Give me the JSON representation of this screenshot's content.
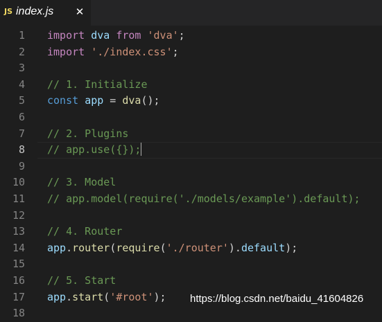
{
  "tab": {
    "icon_text": "JS",
    "filename": "index.js",
    "close_glyph": "✕",
    "icon": "close-icon"
  },
  "editor": {
    "active_line": 8,
    "lines": [
      {
        "num": "1",
        "tokens": [
          [
            "kw2",
            "import"
          ],
          [
            "p",
            " "
          ],
          [
            "var",
            "dva"
          ],
          [
            "p",
            " "
          ],
          [
            "kw2",
            "from"
          ],
          [
            "p",
            " "
          ],
          [
            "str",
            "'dva'"
          ],
          [
            "p",
            ";"
          ]
        ]
      },
      {
        "num": "2",
        "tokens": [
          [
            "kw2",
            "import"
          ],
          [
            "p",
            " "
          ],
          [
            "str",
            "'./index.css'"
          ],
          [
            "p",
            ";"
          ]
        ]
      },
      {
        "num": "3",
        "tokens": []
      },
      {
        "num": "4",
        "tokens": [
          [
            "cm",
            "// 1. Initialize"
          ]
        ]
      },
      {
        "num": "5",
        "tokens": [
          [
            "kw",
            "const"
          ],
          [
            "p",
            " "
          ],
          [
            "var",
            "app"
          ],
          [
            "p",
            " = "
          ],
          [
            "fn",
            "dva"
          ],
          [
            "p",
            "();"
          ]
        ]
      },
      {
        "num": "6",
        "tokens": []
      },
      {
        "num": "7",
        "tokens": [
          [
            "cm",
            "// 2. Plugins"
          ]
        ]
      },
      {
        "num": "8",
        "tokens": [
          [
            "cm",
            "// app.use({});"
          ]
        ],
        "cursor": true
      },
      {
        "num": "9",
        "tokens": []
      },
      {
        "num": "10",
        "tokens": [
          [
            "cm",
            "// 3. Model"
          ]
        ]
      },
      {
        "num": "11",
        "tokens": [
          [
            "cm",
            "// app.model(require('./models/example').default);"
          ]
        ]
      },
      {
        "num": "12",
        "tokens": []
      },
      {
        "num": "13",
        "tokens": [
          [
            "cm",
            "// 4. Router"
          ]
        ]
      },
      {
        "num": "14",
        "tokens": [
          [
            "var",
            "app"
          ],
          [
            "p",
            "."
          ],
          [
            "fn",
            "router"
          ],
          [
            "p",
            "("
          ],
          [
            "fn",
            "require"
          ],
          [
            "p",
            "("
          ],
          [
            "str",
            "'./router'"
          ],
          [
            "p",
            ")."
          ],
          [
            "var",
            "default"
          ],
          [
            "p",
            ");"
          ]
        ]
      },
      {
        "num": "15",
        "tokens": []
      },
      {
        "num": "16",
        "tokens": [
          [
            "cm",
            "// 5. Start"
          ]
        ]
      },
      {
        "num": "17",
        "tokens": [
          [
            "var",
            "app"
          ],
          [
            "p",
            "."
          ],
          [
            "fn",
            "start"
          ],
          [
            "p",
            "("
          ],
          [
            "str",
            "'#root'"
          ],
          [
            "p",
            ");"
          ]
        ]
      },
      {
        "num": "18",
        "tokens": []
      }
    ]
  },
  "watermark": "https://blog.csdn.net/baidu_41604826",
  "colors": {
    "background": "#1e1e1e",
    "keyword": "#569cd6",
    "import_keyword": "#c586c0",
    "string": "#ce9178",
    "variable": "#9cdcfe",
    "function": "#dcdcaa",
    "comment": "#6a9955",
    "line_number": "#858585"
  }
}
